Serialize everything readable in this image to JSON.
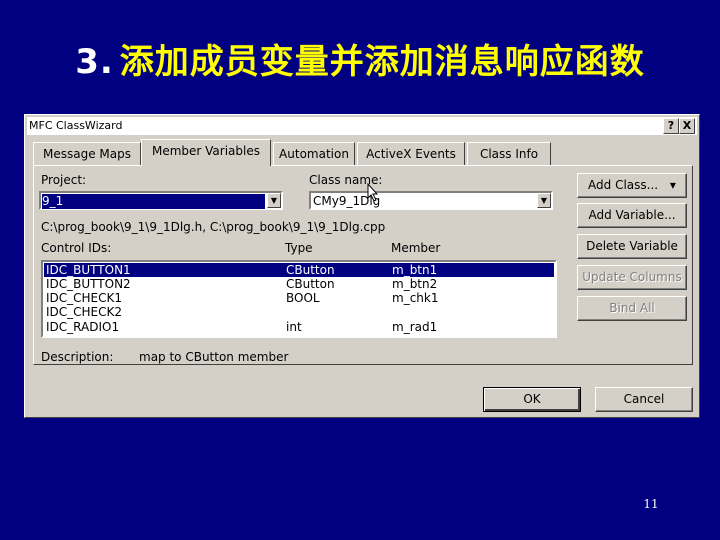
{
  "slide": {
    "number": "3.",
    "title": "添加成员变量并添加消息响应函数",
    "page_number": "11"
  },
  "window": {
    "title": "MFC ClassWizard",
    "help_label": "?",
    "close_label": "X"
  },
  "tabs": [
    {
      "label": "Message Maps",
      "active": false
    },
    {
      "label": "Member Variables",
      "active": true
    },
    {
      "label": "Automation",
      "active": false
    },
    {
      "label": "ActiveX Events",
      "active": false
    },
    {
      "label": "Class Info",
      "active": false
    }
  ],
  "project": {
    "label": "Project:",
    "value": "9_1"
  },
  "class_name": {
    "label": "Class name:",
    "value": "CMy9_1Dlg"
  },
  "files_path": "C:\\prog_book\\9_1\\9_1Dlg.h, C:\\prog_book\\9_1\\9_1Dlg.cpp",
  "columns": {
    "control_ids": "Control IDs:",
    "type": "Type",
    "member": "Member"
  },
  "rows": [
    {
      "id": "IDC_BUTTON1",
      "type": "CButton",
      "member": "m_btn1",
      "selected": true
    },
    {
      "id": "IDC_BUTTON2",
      "type": "CButton",
      "member": "m_btn2",
      "selected": false
    },
    {
      "id": "IDC_CHECK1",
      "type": "BOOL",
      "member": "m_chk1",
      "selected": false
    },
    {
      "id": "IDC_CHECK2",
      "type": "",
      "member": "",
      "selected": false
    },
    {
      "id": "IDC_RADIO1",
      "type": "int",
      "member": "m_rad1",
      "selected": false
    }
  ],
  "description": {
    "label": "Description:",
    "value": "map to CButton member"
  },
  "buttons": {
    "add_class": "Add Class...",
    "add_class_arrow": "▾",
    "add_variable": "Add Variable...",
    "delete_variable": "Delete Variable",
    "update_columns": "Update Columns",
    "bind_all": "Bind All",
    "ok": "OK",
    "cancel": "Cancel"
  },
  "icons": {
    "dropdown": "chevron-down-icon",
    "pointer": "mouse-pointer-icon"
  },
  "colors": {
    "slide_background": "#000080",
    "title_text": "#ffff00",
    "selection": "#000080",
    "dialog_face": "#d4d0c8"
  }
}
